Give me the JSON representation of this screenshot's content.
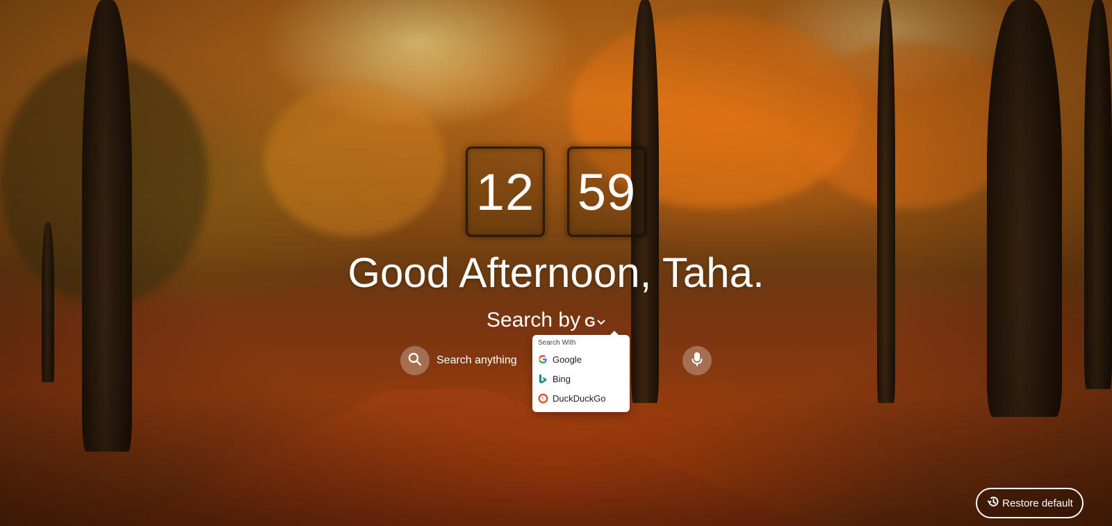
{
  "clock": {
    "hours": "12",
    "minutes": "59"
  },
  "greeting": "Good Afternoon, Taha.",
  "search_by": {
    "label": "Search by",
    "selected_engine_glyph": "G"
  },
  "search": {
    "placeholder": "Search anything"
  },
  "engine_menu": {
    "heading": "Search With",
    "items": [
      {
        "label": "Google",
        "icon": "google-icon"
      },
      {
        "label": "Bing",
        "icon": "bing-icon"
      },
      {
        "label": "DuckDuckGo",
        "icon": "duckduckgo-icon"
      }
    ]
  },
  "restore": {
    "label": "Restore default"
  },
  "colors": {
    "text": "#ffffff",
    "menu_bg": "#ffffff",
    "bing": "#138a7a",
    "duckduckgo": "#de5833"
  }
}
